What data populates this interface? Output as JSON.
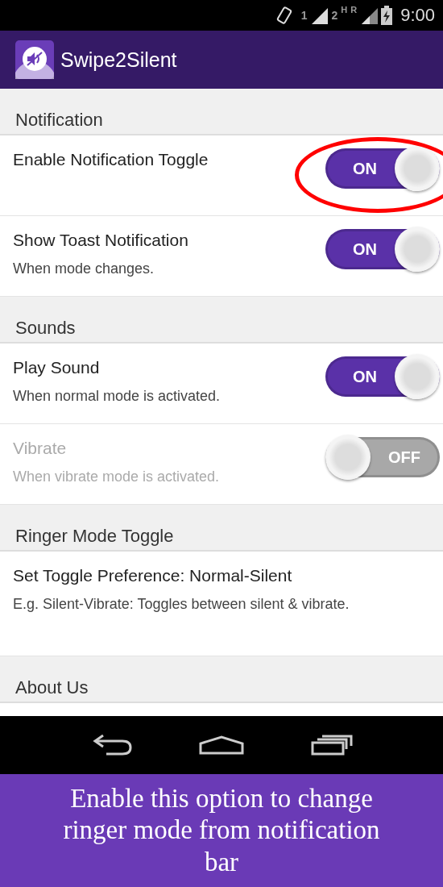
{
  "status_bar": {
    "sim_1": "1",
    "sim_2": "2",
    "network_type": "H",
    "roaming": "R",
    "time": "9:00"
  },
  "app_bar": {
    "title": "Swipe2Silent"
  },
  "sections": [
    {
      "header": "Notification",
      "items": [
        {
          "kind": "toggle",
          "title": "Enable Notification Toggle",
          "on": true,
          "disabled": false,
          "highlighted": true,
          "switch_label": "ON"
        },
        {
          "kind": "toggle",
          "title": "Show Toast Notification",
          "summary": "When mode changes.",
          "on": true,
          "disabled": false,
          "highlighted": false,
          "switch_label": "ON"
        }
      ]
    },
    {
      "header": "Sounds",
      "items": [
        {
          "kind": "toggle",
          "title": "Play Sound",
          "summary": "When normal mode is activated.",
          "on": true,
          "disabled": false,
          "highlighted": false,
          "switch_label": "ON"
        },
        {
          "kind": "toggle",
          "title": "Vibrate",
          "summary": "When vibrate mode is activated.",
          "on": false,
          "disabled": true,
          "highlighted": false,
          "switch_label": "OFF"
        }
      ]
    },
    {
      "header": "Ringer Mode Toggle",
      "items": [
        {
          "kind": "text",
          "title": "Set Toggle Preference:  Normal-Silent",
          "summary": "E.g. Silent-Vibrate: Toggles between silent & vibrate."
        }
      ]
    },
    {
      "header": "About Us"
    }
  ],
  "caption": "Enable this option to change ringer mode from notification bar"
}
